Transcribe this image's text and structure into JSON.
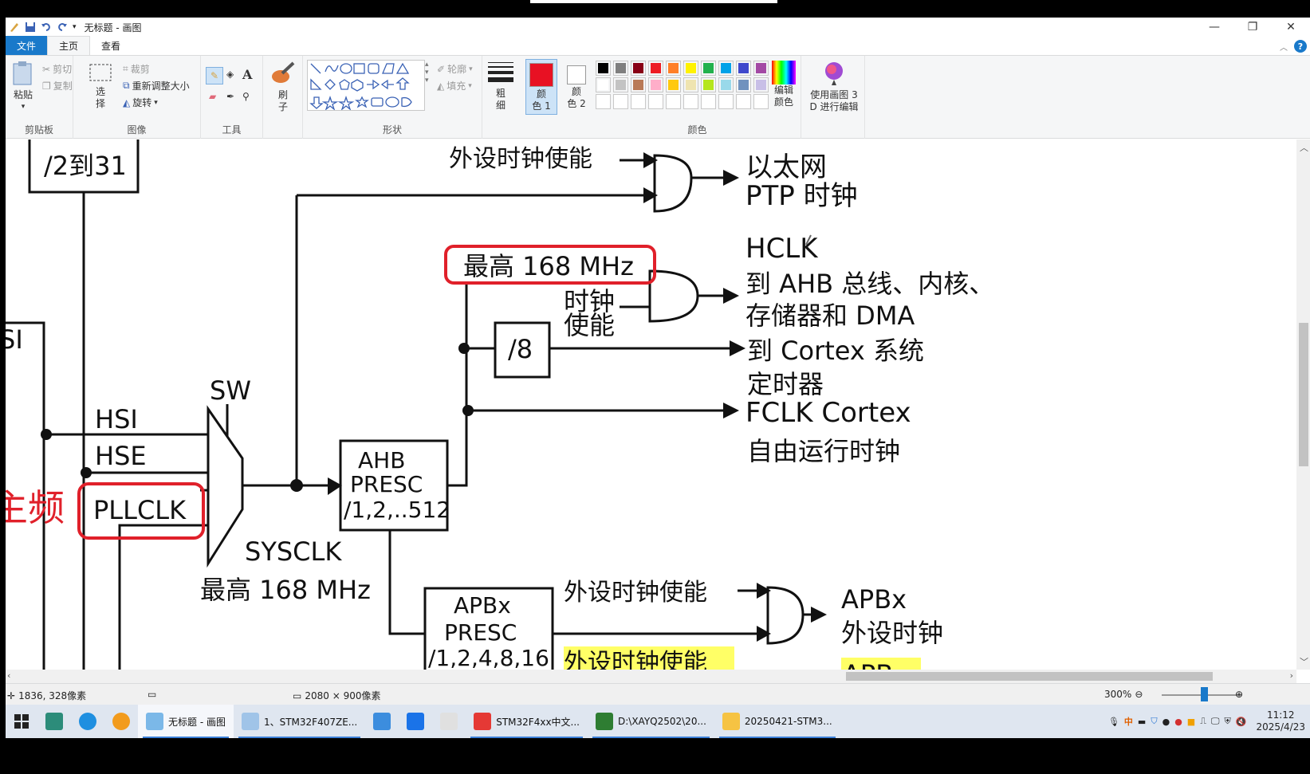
{
  "window": {
    "title": "无标题 - 画图",
    "minimize": "—",
    "restore": "❐",
    "close": "✕"
  },
  "tabs": {
    "file": "文件",
    "home": "主页",
    "view": "查看"
  },
  "ribbon": {
    "clipboard": {
      "paste": "粘贴",
      "cut": "剪切",
      "copy": "复制",
      "label": "剪贴板"
    },
    "image": {
      "select": "选\n择",
      "crop": "裁剪",
      "resize": "重新调整大小",
      "rotate": "旋转",
      "label": "图像"
    },
    "tools": {
      "label": "工具"
    },
    "brushes": {
      "label": "刷\n子"
    },
    "shapes": {
      "outline": "轮廓",
      "fill": "填充",
      "label": "形状"
    },
    "size": {
      "label": "粗\n细"
    },
    "color1": {
      "label": "颜\n色 1",
      "color": "#e81123"
    },
    "color2": {
      "label": "颜\n色 2",
      "color": "#ffffff"
    },
    "colors": {
      "label": "颜色",
      "row1": [
        "#000000",
        "#7f7f7f",
        "#880015",
        "#ed1c24",
        "#ff7f27",
        "#fff200",
        "#22b14c",
        "#00a2e8",
        "#3f48cc",
        "#a349a4"
      ],
      "row2": [
        "#ffffff",
        "#c3c3c3",
        "#b97a57",
        "#ffaec9",
        "#ffc90e",
        "#efe4b0",
        "#b5e61d",
        "#99d9ea",
        "#7092be",
        "#c8bfe7"
      ]
    },
    "edit_colors": "编辑\n颜色",
    "paint3d": "使用画图 3\nD 进行编辑"
  },
  "diagram": {
    "top_label": "/2到31",
    "ptp_enable": "外设时钟使能",
    "ethernet": "以太网",
    "ptp_clock": "PTP 时钟",
    "max168_top": "最高 168 MHz",
    "hclk": "HCLK",
    "hclk_line1": "到 AHB 总线、内核、",
    "hclk_line2": "存储器和 DMA",
    "clock_enable_1": "时钟",
    "clock_enable_2": "使能",
    "div8": "/8",
    "cortex_timer_1": "到 Cortex 系统",
    "cortex_timer_2": "定时器",
    "fclk_1": "FCLK Cortex",
    "fclk_2": "自由运行时钟",
    "sw": "SW",
    "hsi": "HSI",
    "hse": "HSE",
    "pllclk": "PLLCLK",
    "freq_left": "主频",
    "si_left": "SI",
    "ahb_1": "AHB",
    "ahb_2": "PRESC",
    "ahb_3": "/1,2,..512",
    "sysclk": "SYSCLK",
    "sysclk_max": "最高 168 MHz",
    "apb_1": "APBx",
    "apb_2": "PRESC",
    "apb_3": "/1,2,4,8,16",
    "apb_enable": "外设时钟使能",
    "apb_enable_2": "外设时钟使能",
    "apbx_out_1": "APBx",
    "apbx_out_2": "外设时钟",
    "apb_bottom": "APB"
  },
  "status": {
    "cursor": "1836, 328像素",
    "size": "2080 × 900像素",
    "zoom": "300%"
  },
  "taskbar": {
    "items": [
      {
        "label": "无标题 - 画图",
        "color": "#7bb8e8",
        "active": true
      },
      {
        "label": "1、STM32F407ZE...",
        "color": "#a0c4e8",
        "active": false
      },
      {
        "label": "",
        "color": "#3c8dde",
        "active": false
      },
      {
        "label": "",
        "color": "#1a73e8",
        "active": false
      },
      {
        "label": "",
        "color": "#e0e0e0",
        "active": false
      },
      {
        "label": "STM32F4xx中文...",
        "color": "#e53935",
        "active": false
      },
      {
        "label": "D:\\XAYQ2502\\20...",
        "color": "#2e7d32",
        "active": false
      },
      {
        "label": "20250421-STM3...",
        "color": "#f6c343",
        "active": false
      }
    ],
    "time": "11:12",
    "date": "2025/4/23",
    "ime": "中"
  }
}
